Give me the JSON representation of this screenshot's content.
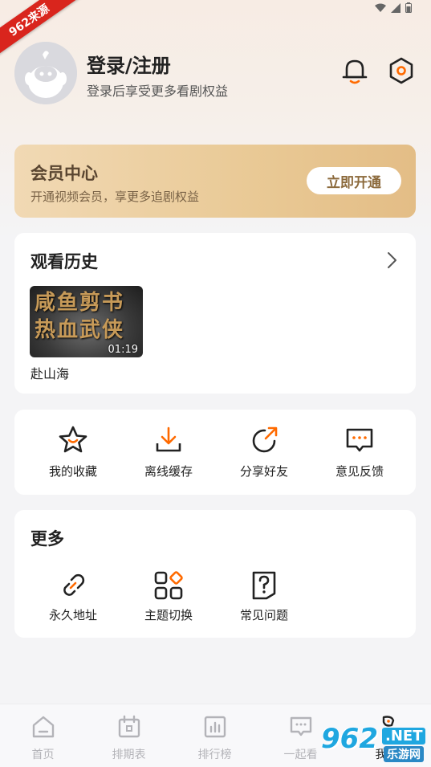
{
  "watermark": {
    "ribbon": "962来源",
    "site_big": "962",
    "site_net": ".NET",
    "site_cn": "乐游网"
  },
  "profile": {
    "title": "登录/注册",
    "subtitle": "登录后享受更多看剧权益"
  },
  "vip": {
    "title": "会员中心",
    "subtitle": "开通视频会员，享更多追剧权益",
    "button": "立即开通"
  },
  "history": {
    "title": "观看历史",
    "items": [
      {
        "name": "赴山海",
        "poster_text": [
          "咸鱼剪书",
          "热血武侠"
        ],
        "time": "01:19"
      }
    ]
  },
  "actions": [
    {
      "label": "我的收藏",
      "icon": "star-icon"
    },
    {
      "label": "离线缓存",
      "icon": "download-icon"
    },
    {
      "label": "分享好友",
      "icon": "share-icon"
    },
    {
      "label": "意见反馈",
      "icon": "feedback-icon"
    }
  ],
  "more": {
    "title": "更多",
    "items": [
      {
        "label": "永久地址",
        "icon": "link-icon"
      },
      {
        "label": "主题切换",
        "icon": "theme-grid-icon"
      },
      {
        "label": "常见问题",
        "icon": "faq-icon"
      }
    ]
  },
  "tabs": [
    {
      "label": "首页",
      "icon": "home-icon"
    },
    {
      "label": "排期表",
      "icon": "calendar-icon"
    },
    {
      "label": "排行榜",
      "icon": "ranking-icon"
    },
    {
      "label": "一起看",
      "icon": "watch-together-icon"
    },
    {
      "label": "我的",
      "icon": "profile-icon",
      "active": true
    }
  ],
  "colors": {
    "accent": "#ff6a00",
    "vip_gold": "#e9c995",
    "background": "#f4f4f6"
  }
}
